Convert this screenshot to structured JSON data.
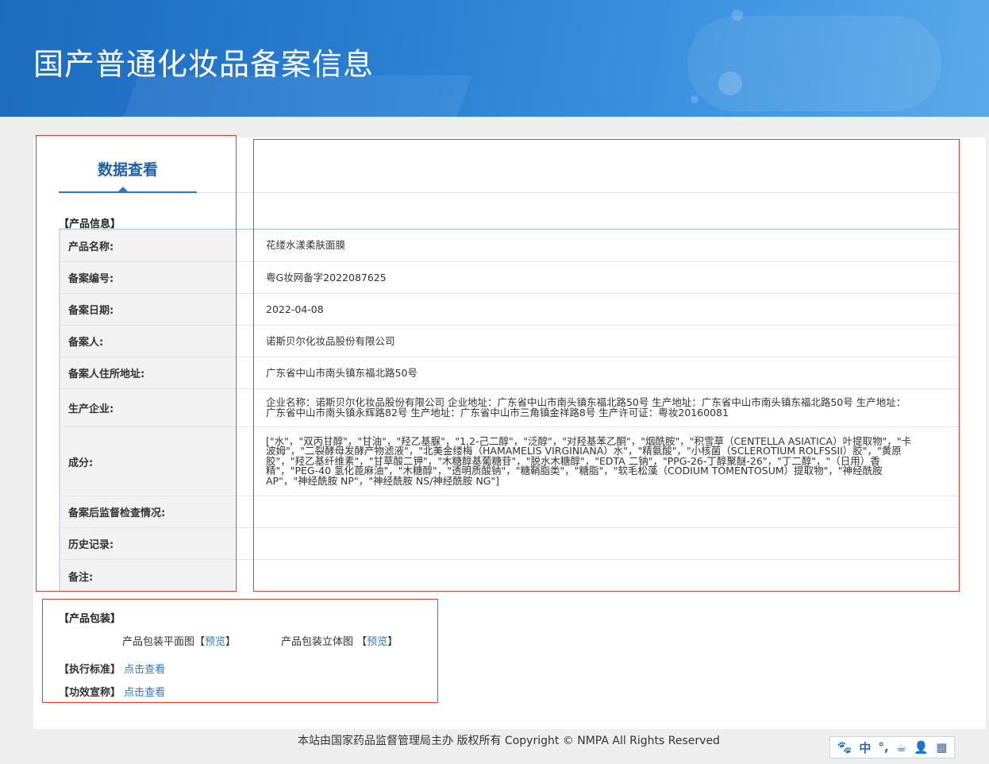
{
  "page": {
    "title": "国产普通化妆品备案信息",
    "tab_label": "数据查看"
  },
  "product_info": {
    "section_title": "【产品信息】",
    "rows": [
      {
        "label": "产品名称:",
        "value": "花缕水漾柔肤面膜"
      },
      {
        "label": "备案编号:",
        "value": "粤G妆网备字2022087625"
      },
      {
        "label": "备案日期:",
        "value": "2022-04-08"
      },
      {
        "label": "备案人:",
        "value": "诺斯贝尔化妆品股份有限公司"
      },
      {
        "label": "备案人住所地址:",
        "value": "广东省中山市南头镇东福北路50号"
      },
      {
        "label": "生产企业:",
        "value": "企业名称：诺斯贝尔化妆品股份有限公司 企业地址：广东省中山市南头镇东福北路50号 生产地址：广东省中山市南头镇东福北路50号 生产地址：广东省中山市南头镇永辉路82号 生产地址：广东省中山市三角镇金祥路8号 生产许可证：粤妆20160081"
      },
      {
        "label": "成分:",
        "value": "[\"水\"，\"双丙甘醇\"，\"甘油\"，\"羟乙基脲\"，\"1,2-己二醇\"，\"泛醇\"，\"对羟基苯乙酮\"，\"烟酰胺\"，\"积雪草（CENTELLA ASIATICA）叶提取物\"，\"卡波姆\"，\"二裂酵母发酵产物滤液\"，\"北美金缕梅（HAMAMELIS VIRGINIANA）水\"，\"精氨酸\"，\"小核菌（SCLEROTIUM ROLFSSII）胶\"，\"黄原胶\"，\"羟乙基纤维素\"，\"甘草酸二钾\"，\"木糖醇基葡糖苷\"，\"脱水木糖醇\"，\"EDTA 二钠\"，\"PPG-26-丁醇聚醚-26\"，\"丁二醇\"，\"（日用）香精\"，\"PEG-40 氢化蓖麻油\"，\"木糖醇\"，\"透明质酸钠\"，\"糖鞘脂类\"，\"糖脂\"，\"软毛松藻（CODIUM TOMENTOSUM）提取物\"，\"神经酰胺 AP\"，\"神经酰胺 NP\"，\"神经酰胺 NS/神经酰胺 NG\"]"
      },
      {
        "label": "备案后监督检查情况:",
        "value": ""
      },
      {
        "label": "历史记录:",
        "value": ""
      },
      {
        "label": "备注:",
        "value": ""
      }
    ]
  },
  "packaging": {
    "section_title": "【产品包装】",
    "flat_label": "产品包装平面图",
    "flat_link": "预览",
    "solid_label": "产品包装立体图",
    "solid_link": "预览",
    "bracket_open": "【",
    "bracket_close": "】"
  },
  "standard": {
    "label": "【执行标准】",
    "link": "点击查看"
  },
  "efficacy": {
    "label": "【功效宣称】",
    "link": "点击查看"
  },
  "footer": {
    "text": "本站由国家药品监督管理局主办 版权所有 Copyright © NMPA All Rights Reserved"
  },
  "toolbar": {
    "items": [
      {
        "name": "paw-icon",
        "glyph": "🐾"
      },
      {
        "name": "chinese-mode-icon",
        "glyph": "中"
      },
      {
        "name": "punctuation-icon",
        "glyph": "°,"
      },
      {
        "name": "cup-icon",
        "glyph": "☕"
      },
      {
        "name": "user-icon",
        "glyph": "👤"
      },
      {
        "name": "grid-icon",
        "glyph": "▦"
      }
    ]
  },
  "colors": {
    "accent": "#2f78c4",
    "annotation_red": "#e03a3a",
    "banner": "#2a7fd3"
  }
}
